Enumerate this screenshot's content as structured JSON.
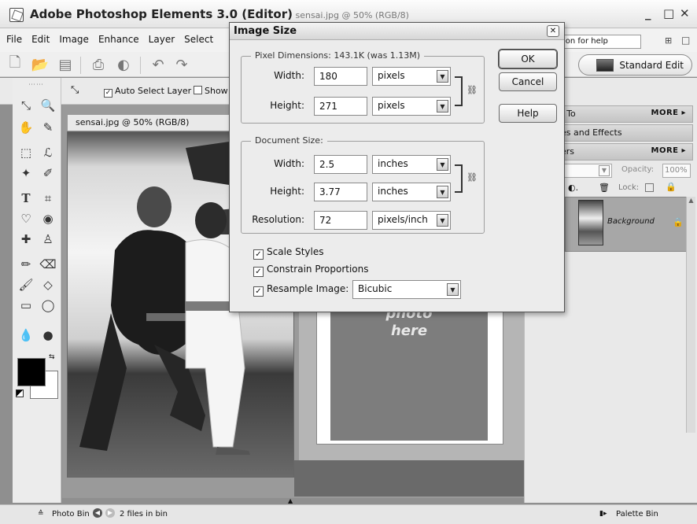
{
  "window": {
    "app_name": "Adobe Photoshop Elements 3.0 (Editor)",
    "subtitle": " sensai.jpg @ 50% (RGB/8)",
    "minimize": "_",
    "maximize": "□",
    "close": "✕"
  },
  "menu": [
    "File",
    "Edit",
    "Image",
    "Enhance",
    "Layer",
    "Select"
  ],
  "help_search": {
    "value": "tion for help"
  },
  "toolbar": {
    "standard_edit_label": "Standard Edit"
  },
  "options_bar": {
    "auto_select_label": "Auto Select Layer",
    "show_label": "Show"
  },
  "document": {
    "tab_title": "sensai.jpg @ 50% (RGB/8)",
    "frame_text_line1": "photo",
    "frame_text_line2": "here"
  },
  "palette": {
    "bar1_label": "/ To",
    "bar1_more": "MORE ▸",
    "bar2_label": "es and Effects",
    "bar3_label": "ers",
    "bar3_more": "MORE ▸",
    "opacity_label": "Opacity:",
    "opacity_value": "100%",
    "lock_label": "Lock:",
    "layer_name": "Background"
  },
  "status": {
    "photo_bin": "Photo Bin",
    "files_in_bin": "2 files in bin",
    "palette_bin": "Palette Bin"
  },
  "dialog": {
    "title": "Image Size",
    "pixel_dimensions": {
      "label": "Pixel Dimensions:  143.1K (was 1.13M)",
      "width_label": "Width:",
      "width_value": "180",
      "width_unit": "pixels",
      "height_label": "Height:",
      "height_value": "271",
      "height_unit": "pixels"
    },
    "document_size": {
      "label": "Document Size:",
      "width_label": "Width:",
      "width_value": "2.5",
      "width_unit": "inches",
      "height_label": "Height:",
      "height_value": "3.77",
      "height_unit": "inches",
      "resolution_label": "Resolution:",
      "resolution_value": "72",
      "resolution_unit": "pixels/inch"
    },
    "scale_styles": {
      "label": "Scale Styles",
      "checked": true
    },
    "constrain_proportions": {
      "label": "Constrain Proportions",
      "checked": true
    },
    "resample_image": {
      "label": "Resample Image:",
      "checked": true,
      "method": "Bicubic"
    },
    "buttons": {
      "ok": "OK",
      "cancel": "Cancel",
      "help": "Help"
    }
  }
}
